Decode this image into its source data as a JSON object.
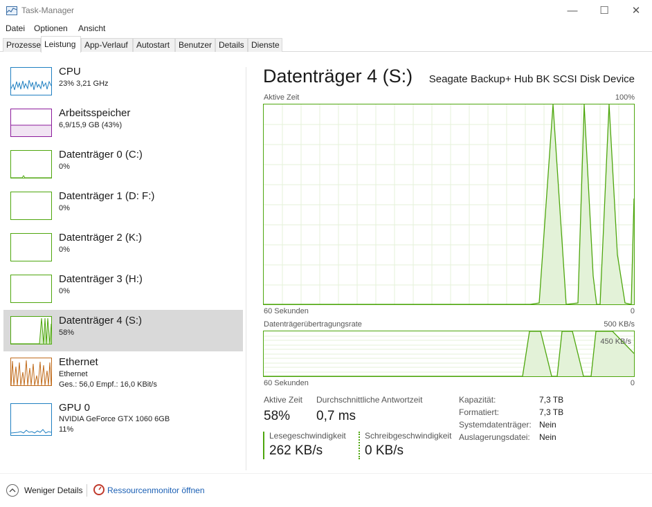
{
  "window": {
    "title": "Task-Manager",
    "minimize_glyph": "—",
    "maximize_glyph": "☐",
    "close_glyph": "✕"
  },
  "menu": [
    "Datei",
    "Optionen",
    "Ansicht"
  ],
  "tabs": [
    "Prozesse",
    "Leistung",
    "App-Verlauf",
    "Autostart",
    "Benutzer",
    "Details",
    "Dienste"
  ],
  "active_tab": "Leistung",
  "sidebar": {
    "items": [
      {
        "title": "CPU",
        "lines": [
          "23%  3,21 GHz"
        ],
        "color": "#1f7fc1",
        "icon": "cpu-graph"
      },
      {
        "title": "Arbeitsspeicher",
        "lines": [
          "6,9/15,9 GB (43%)"
        ],
        "color": "#8b1a9b",
        "icon": "memory-graph"
      },
      {
        "title": "Datenträger 0 (C:)",
        "lines": [
          "0%"
        ],
        "color": "#4da60c",
        "icon": "disk-graph"
      },
      {
        "title": "Datenträger 1 (D: F:)",
        "lines": [
          "0%"
        ],
        "color": "#4da60c",
        "icon": "disk-graph"
      },
      {
        "title": "Datenträger 2 (K:)",
        "lines": [
          "0%"
        ],
        "color": "#4da60c",
        "icon": "disk-graph"
      },
      {
        "title": "Datenträger 3 (H:)",
        "lines": [
          "0%"
        ],
        "color": "#4da60c",
        "icon": "disk-graph"
      },
      {
        "title": "Datenträger 4 (S:)",
        "lines": [
          "58%"
        ],
        "color": "#4da60c",
        "icon": "disk-graph",
        "selected": true
      },
      {
        "title": "Ethernet",
        "lines": [
          "Ethernet",
          "Ges.: 56,0  Empf.: 16,0 KBit/s"
        ],
        "color": "#c06a1a",
        "icon": "network-graph"
      },
      {
        "title": "GPU 0",
        "lines": [
          "NVIDIA GeForce GTX 1060 6GB",
          "11%"
        ],
        "color": "#1f7fc1",
        "icon": "gpu-graph"
      }
    ]
  },
  "detail": {
    "title": "Datenträger 4 (S:)",
    "device": "Seagate Backup+ Hub BK SCSI Disk Device",
    "graph1": {
      "label": "Aktive Zeit",
      "max_label": "100%",
      "time_label": "60 Sekunden",
      "zero_label": "0"
    },
    "graph2": {
      "label": "Datenträgerübertragungsrate",
      "max_label": "500 KB/s",
      "inner_label": "450 KB/s",
      "time_label": "60 Sekunden",
      "zero_label": "0"
    },
    "stats": {
      "active_time_label": "Aktive Zeit",
      "active_time_value": "58%",
      "response_label": "Durchschnittliche Antwortzeit",
      "response_value": "0,7 ms",
      "read_label": "Lesegeschwindigkeit",
      "read_value": "262 KB/s",
      "write_label": "Schreibgeschwindigkeit",
      "write_value": "0 KB/s"
    },
    "properties": [
      {
        "label": "Kapazität:",
        "value": "7,3 TB"
      },
      {
        "label": "Formatiert:",
        "value": "7,3 TB"
      },
      {
        "label": "Systemdatenträger:",
        "value": "Nein"
      },
      {
        "label": "Auslagerungsdatei:",
        "value": "Nein"
      }
    ]
  },
  "footer": {
    "less_details": "Weniger Details",
    "resource_monitor": "Ressourcenmonitor öffnen"
  },
  "colors": {
    "disk_accent": "#4da60c",
    "selection": "#d9d9d9",
    "link": "#1a5fb4"
  }
}
